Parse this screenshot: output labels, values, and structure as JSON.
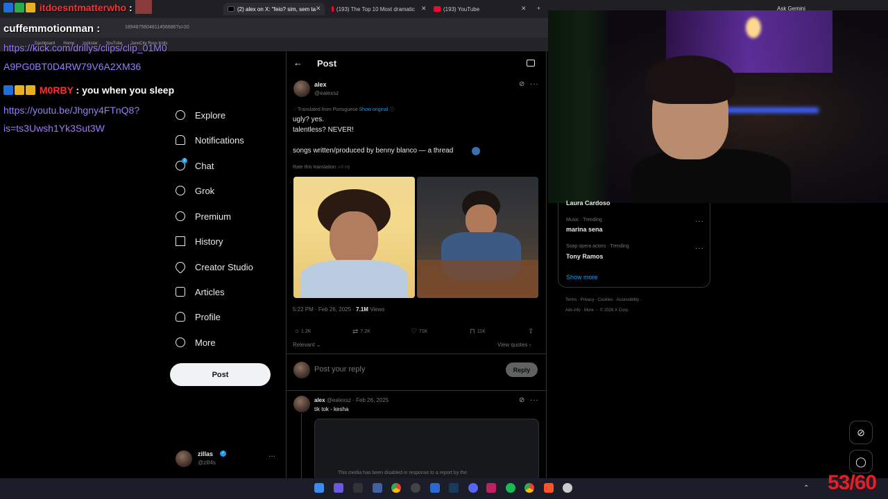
{
  "browser": {
    "tabs": [
      {
        "label": "(2) alex on X: \"feio? sim, sem ta"
      },
      {
        "label": "(193) The Top 10 Most dramatic"
      },
      {
        "label": "(193) YouTube"
      }
    ],
    "ask_gemini": "Ask Gemini",
    "url_fragment": "1894875604811456686?s=20",
    "bookmarks": [
      "Dashboard",
      "Home",
      "rockstar",
      "YouTube",
      "JanoCity Ross trolls"
    ]
  },
  "chat": {
    "messages": [
      {
        "user": "itdoesntmatterwho",
        "text": ":"
      },
      {
        "user": "cuffemmotionman",
        "text": ":"
      },
      {
        "link_lines": [
          "https://kick.com/drillys/clips/clip_01M0",
          "A9PG0BT0D4RW79V6A2XM36"
        ]
      },
      {
        "user": "M0RBY",
        "text": ": you when you sleep"
      },
      {
        "link_lines": [
          "https://youtu.be/Jhgny4FTnQ8?",
          "is=ts3Uwsh1Yk3Sut3W"
        ]
      }
    ]
  },
  "nav": {
    "items": [
      {
        "label": "Explore",
        "icon": "search-icon"
      },
      {
        "label": "Notifications",
        "icon": "bell-icon"
      },
      {
        "label": "Chat",
        "icon": "chat-icon"
      },
      {
        "label": "Grok",
        "icon": "grok-icon"
      },
      {
        "label": "Premium",
        "icon": "premium-icon"
      },
      {
        "label": "History",
        "icon": "bookmark-icon"
      },
      {
        "label": "Creator Studio",
        "icon": "rocket-icon"
      },
      {
        "label": "Articles",
        "icon": "articles-icon"
      },
      {
        "label": "Profile",
        "icon": "person-icon"
      },
      {
        "label": "More",
        "icon": "more-circle-icon"
      }
    ],
    "chat_badge": "2",
    "post_button": "Post",
    "account": {
      "name": "zillas",
      "handle": "@zill4s"
    }
  },
  "post": {
    "header_title": "Post",
    "author": {
      "name": "alex",
      "handle": "@ealexsz"
    },
    "translated_label": "Translated from Portuguese",
    "show_original": "Show original",
    "text_lines": [
      "ugly? yes.",
      "talentless? NEVER!",
      "songs written/produced by benny blanco — a thread"
    ],
    "rate_translation": "Rate this translation:",
    "timestamp": "5:22 PM · Feb 26, 2025 ·",
    "views_count": "7.1M",
    "views_label": "Views",
    "stats": {
      "replies": "1.2K",
      "reposts": "7.2K",
      "likes": "71K",
      "bookmarks": "11K"
    },
    "sort_label": "Relevant",
    "view_quotes": "View quotes",
    "reply_placeholder": "Post your reply",
    "reply_button": "Reply"
  },
  "reply": {
    "name": "alex",
    "meta": "@ealexsz · Feb 26, 2025",
    "text": "tik tok - kesha",
    "media_notice": "This media has been disabled in response to a report by the"
  },
  "trending": {
    "partial_name": "Laura Cardoso",
    "items": [
      {
        "category": "Music · Trending",
        "name": "marina sena"
      },
      {
        "category": "Soap opera actors · Trending",
        "name": "Tony Ramos"
      }
    ],
    "show_more": "Show more",
    "footer_line1": [
      "Terms",
      "Privacy",
      "Cookies",
      "Accessibility"
    ],
    "footer_line2": [
      "Ads info",
      "More ···",
      "© 2026 X Corp."
    ]
  },
  "overlay": {
    "counter": "53/60"
  },
  "colors": {
    "accent": "#1d9bf0",
    "chat_red": "#ff3030",
    "chat_link": "#9b7bff",
    "counter": "#e0202a"
  }
}
